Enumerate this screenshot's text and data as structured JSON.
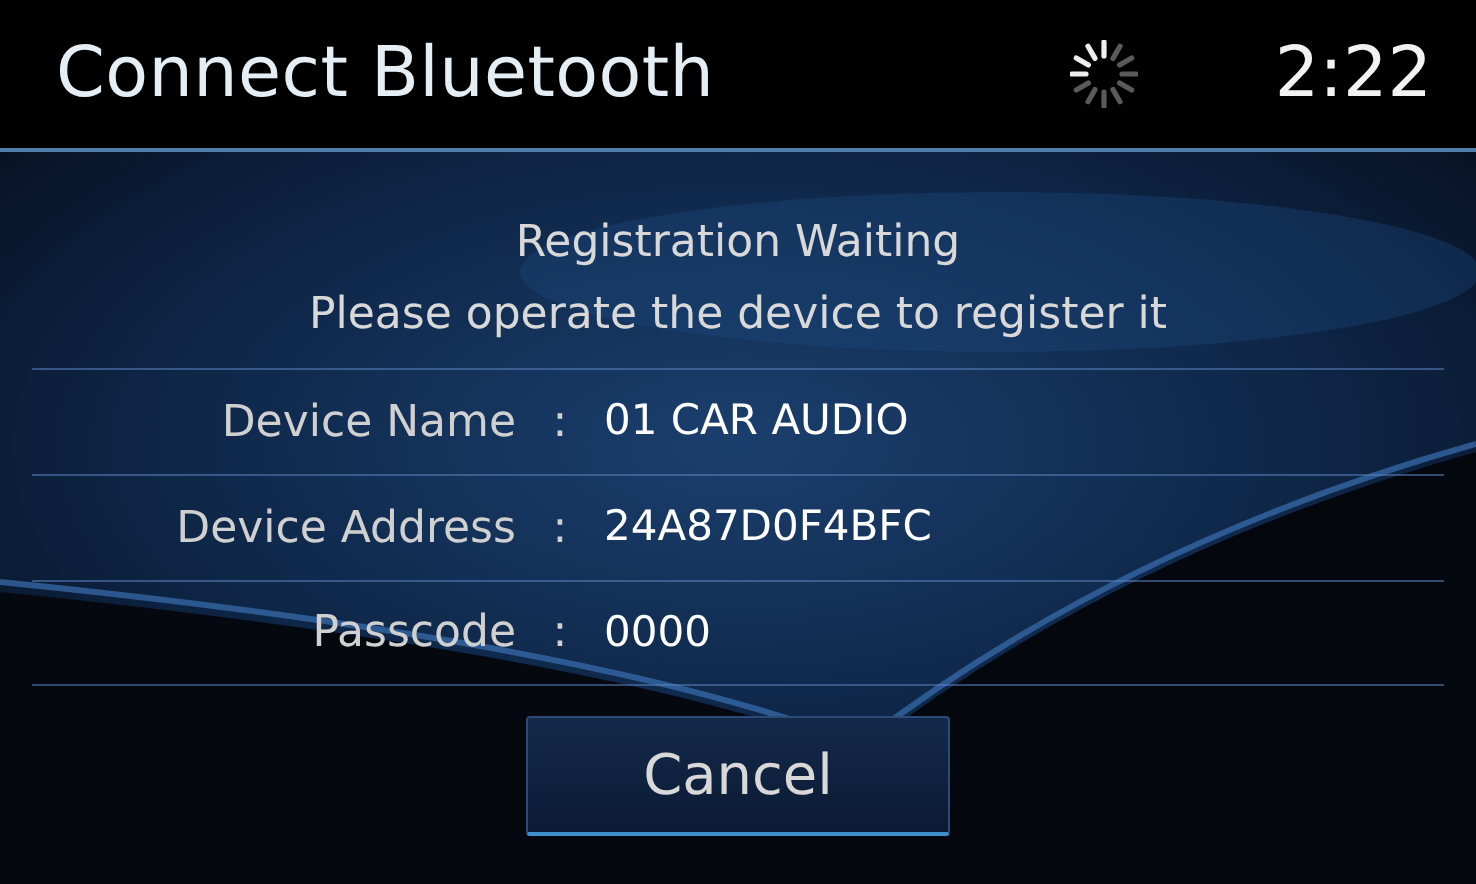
{
  "header": {
    "title": "Connect Bluetooth",
    "busy": true,
    "time": "2:22"
  },
  "message": [
    "Registration Waiting",
    "Please operate the device to register it"
  ],
  "fields": [
    {
      "label": "Device Name",
      "separator": ":",
      "value": "01 CAR AUDIO"
    },
    {
      "label": "Device Address",
      "separator": ":",
      "value": "24A87D0F4BFC"
    },
    {
      "label": "Passcode",
      "separator": ":",
      "value": "0000"
    }
  ],
  "buttons": [
    "Cancel"
  ]
}
